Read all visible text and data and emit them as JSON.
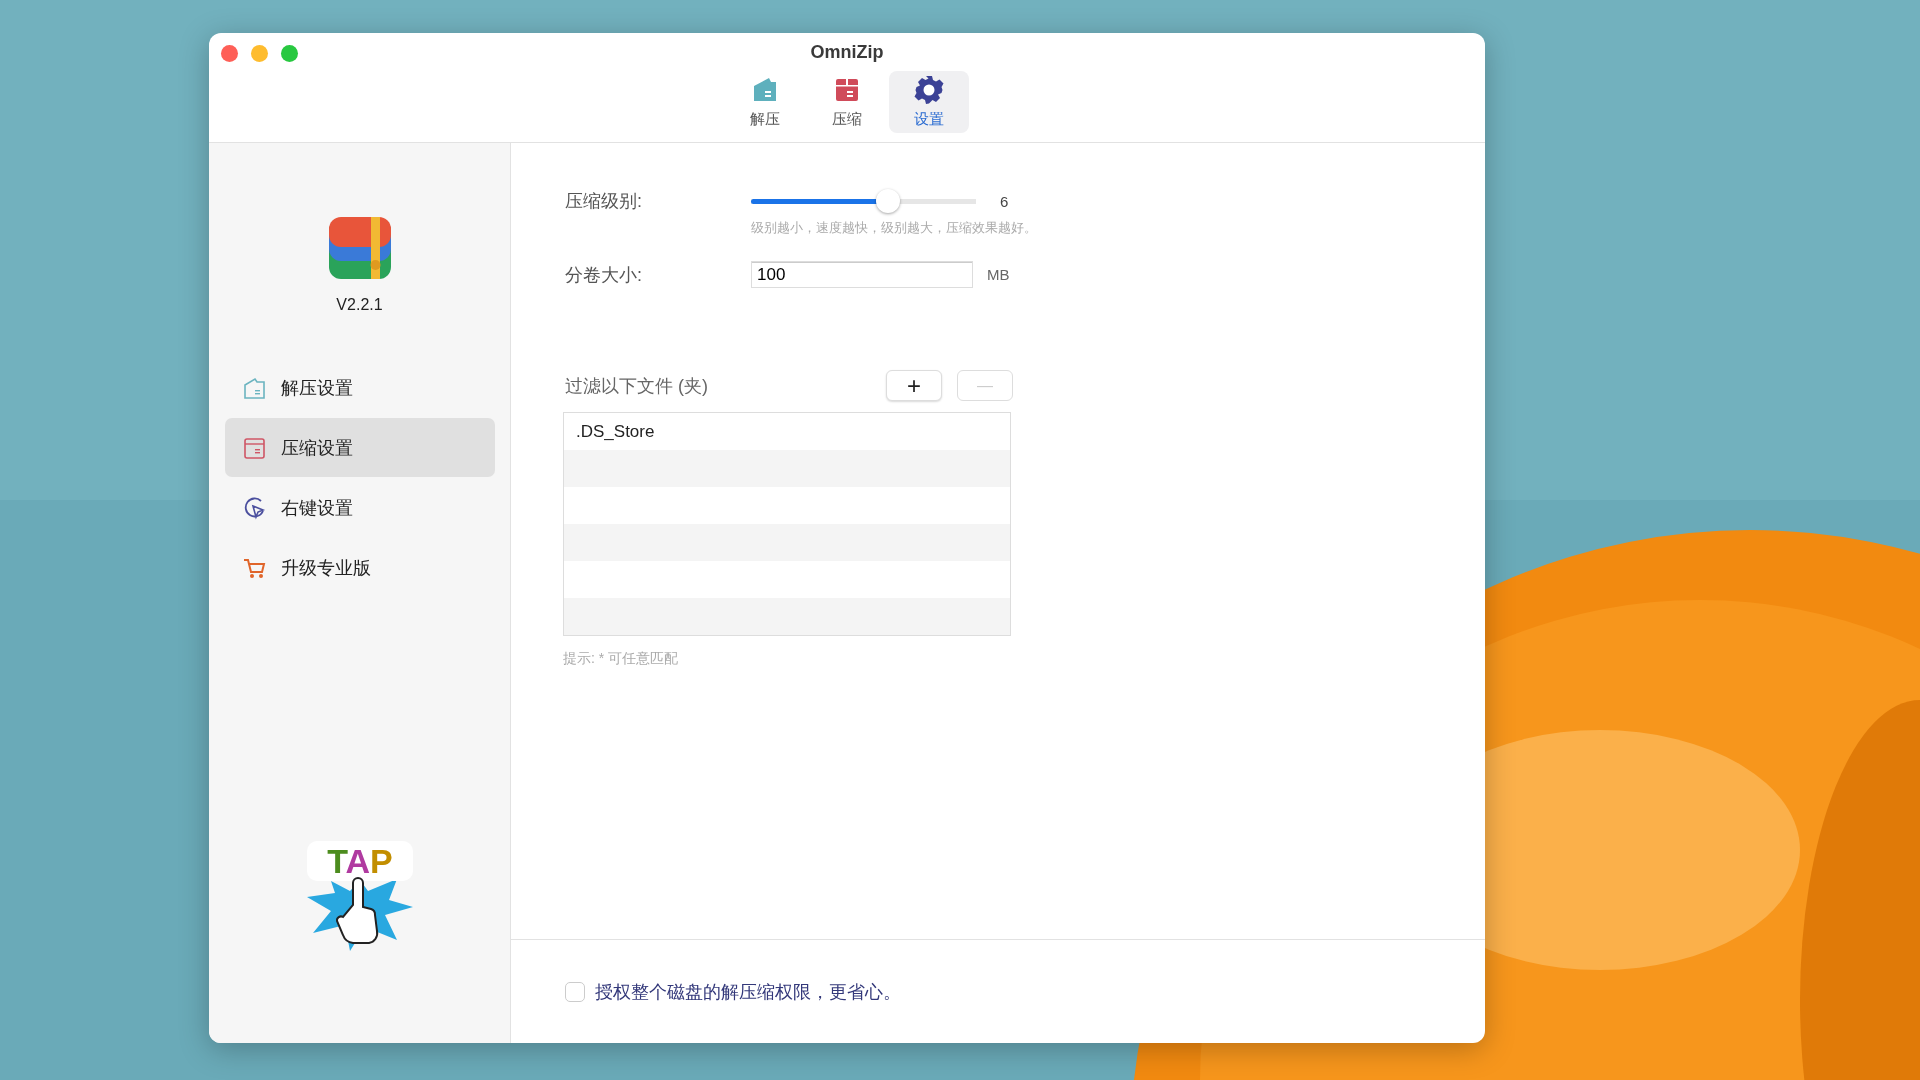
{
  "window": {
    "title": "OmniZip"
  },
  "toolbar": {
    "tabs": [
      {
        "kind": "extract",
        "label": "解压",
        "selected": false
      },
      {
        "kind": "compress",
        "label": "压缩",
        "selected": false
      },
      {
        "kind": "settings",
        "label": "设置",
        "selected": true
      }
    ]
  },
  "sidebar": {
    "version": "V2.2.1",
    "items": [
      {
        "kind": "extract",
        "label": "解压设置",
        "selected": false
      },
      {
        "kind": "compress",
        "label": "压缩设置",
        "selected": true
      },
      {
        "kind": "context",
        "label": "右键设置",
        "selected": false
      },
      {
        "kind": "upgrade",
        "label": "升级专业版",
        "selected": false
      }
    ],
    "sticker": {
      "text": "TAP"
    }
  },
  "settings": {
    "level": {
      "label": "压缩级别:",
      "level": 0.61,
      "reading": "6",
      "hint": "级别越小，速度越快，级别越大，压缩效果越好。"
    },
    "split": {
      "label": "分卷大小:",
      "value": "100",
      "unit": "MB"
    },
    "filter": {
      "label": "过滤以下文件 (夹)",
      "add": "+",
      "remove": "—",
      "remove_disabled": true,
      "entries": [
        ".DS_Store"
      ],
      "hint": "提示: * 可任意匹配"
    },
    "permission": {
      "label": "授权整个磁盘的解压缩权限，更省心。",
      "checked": false
    }
  }
}
